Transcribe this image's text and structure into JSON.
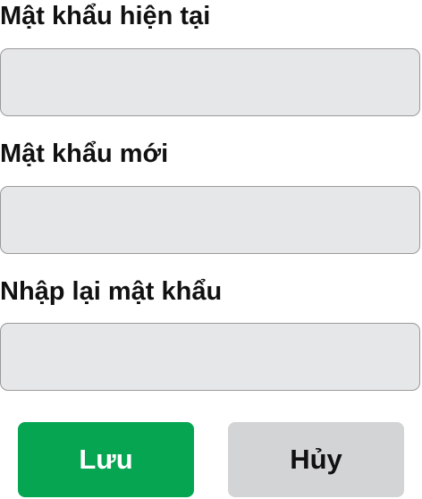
{
  "form": {
    "current_password": {
      "label": "Mật khẩu hiện tại",
      "value": ""
    },
    "new_password": {
      "label": "Mật khẩu mới",
      "value": ""
    },
    "confirm_password": {
      "label": "Nhập lại mật khẩu",
      "value": ""
    }
  },
  "actions": {
    "save_label": "Lưu",
    "cancel_label": "Hủy"
  },
  "colors": {
    "save_bg": "#05a551",
    "cancel_bg": "#d3d4d6",
    "input_bg": "#e6e7e9"
  }
}
